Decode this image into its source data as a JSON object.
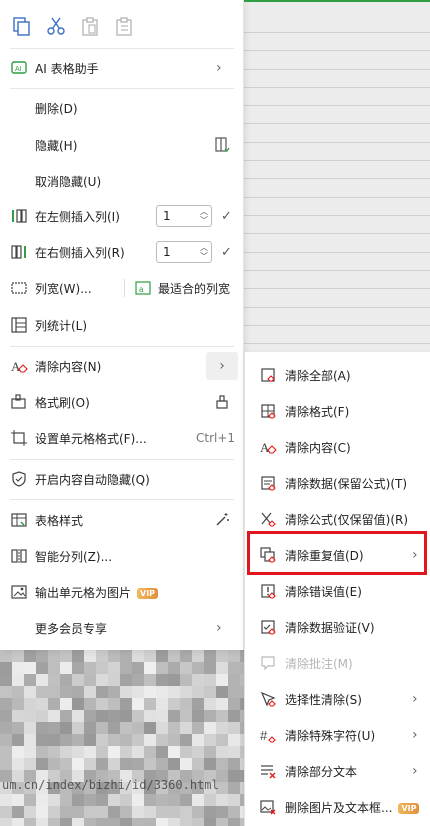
{
  "toolbar": {
    "icons": [
      "copy-icon",
      "cut-icon",
      "paste-icon",
      "paste-special-icon"
    ]
  },
  "menu": {
    "ai_label": "AI 表格助手",
    "delete_label": "删除(D)",
    "hide_label": "隐藏(H)",
    "unhide_label": "取消隐藏(U)",
    "insert_left_label": "在左侧插入列(I)",
    "insert_left_value": "1",
    "insert_right_label": "在右侧插入列(R)",
    "insert_right_value": "1",
    "col_width_label": "列宽(W)...",
    "best_fit_label": "最适合的列宽",
    "col_stats_label": "列统计(L)",
    "clear_content_label": "清除内容(N)",
    "format_painter_label": "格式刷(O)",
    "cell_format_label": "设置单元格格式(F)...",
    "cell_format_shortcut": "Ctrl+1",
    "auto_hide_label": "开启内容自动隐藏(Q)",
    "table_style_label": "表格样式",
    "smart_split_label": "智能分列(Z)...",
    "export_image_label": "输出单元格为图片",
    "export_image_badge": "VIP",
    "member_label": "更多会员专享"
  },
  "submenu": {
    "items": [
      {
        "label": "清除全部(A)",
        "icon": "clear-all-icon"
      },
      {
        "label": "清除格式(F)",
        "icon": "clear-format-icon"
      },
      {
        "label": "清除内容(C)",
        "icon": "clear-content-icon"
      },
      {
        "label": "清除数据(保留公式)(T)",
        "icon": "clear-data-icon"
      },
      {
        "label": "清除公式(仅保留值)(R)",
        "icon": "clear-formula-icon"
      },
      {
        "label": "清除重复值(D)",
        "icon": "clear-duplicates-icon"
      },
      {
        "label": "清除错误值(E)",
        "icon": "clear-errors-icon"
      },
      {
        "label": "清除数据验证(V)",
        "icon": "clear-validation-icon"
      },
      {
        "label": "清除批注(M)",
        "icon": "clear-comments-icon"
      },
      {
        "label": "选择性清除(S)",
        "icon": "selective-clear-icon"
      },
      {
        "label": "清除特殊字符(U)",
        "icon": "clear-special-chars-icon"
      },
      {
        "label": "清除部分文本",
        "icon": "clear-partial-text-icon"
      },
      {
        "label": "删除图片及文本框...",
        "icon": "delete-images-icon",
        "badge": "VIP"
      }
    ]
  },
  "blurred": {
    "url_text": "um.cn/index/bizhi/id/3360.html"
  },
  "colors": {
    "highlight": "#e0161c",
    "accent_green": "#2f9e44",
    "vip_gold": "#e9a64a"
  }
}
